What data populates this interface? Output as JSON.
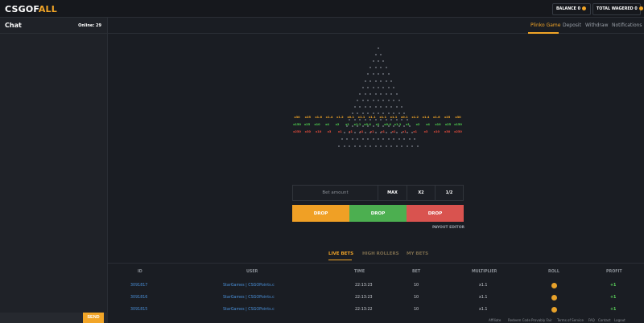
{
  "brand": {
    "logo_main": "CSGOF",
    "logo_accent": "ALL",
    "accent_color": "#f2a527"
  },
  "header": {
    "balance": "BALANCE 0",
    "total_wagered": "TOTAL WAGERED 0"
  },
  "chat": {
    "title": "Chat",
    "online": "Online: 29",
    "send": "SEND"
  },
  "nav": [
    {
      "label": "Plinko Game",
      "active": true
    },
    {
      "label": "Deposit",
      "active": false
    },
    {
      "label": "Withdraw",
      "active": false
    },
    {
      "label": "Notifications",
      "active": false
    }
  ],
  "plinko": {
    "rows": 16,
    "multipliers": {
      "orange": [
        "x30",
        "x25",
        "x1.6",
        "x1.4",
        "x1.2",
        "x0.1",
        "x1.1",
        "x1.1",
        "x1.1",
        "x1.1",
        "x0.1",
        "x1.2",
        "x1.4",
        "x1.6",
        "x25",
        "x30"
      ],
      "green": [
        "x150",
        "x25",
        "x10",
        "x4",
        "x2",
        "x1",
        "x1.1",
        "x0.4",
        "x1",
        "x0.4",
        "x1.1",
        "x1",
        "x2",
        "x4",
        "x10",
        "x25",
        "x150"
      ],
      "red": [
        "x250",
        "x30",
        "x10",
        "x3",
        "x1",
        "x1",
        "x1",
        "x1",
        "x1",
        "x1",
        "x1",
        "x1",
        "x3",
        "x10",
        "x30",
        "x250"
      ]
    },
    "colors": {
      "orange": "#f2a527",
      "green": "#4fd14f",
      "red": "#e74c3c"
    }
  },
  "controls": {
    "bet_placeholder": "Bet amount",
    "max": "MAX",
    "x2": "X2",
    "half": "1/2",
    "drop_labels": [
      "DROP",
      "DROP",
      "DROP"
    ],
    "payout_editor": "PAYOUT EDITOR"
  },
  "bets_tabs": [
    {
      "label": "LIVE BETS",
      "active": true
    },
    {
      "label": "HIGH ROLLERS",
      "active": false
    },
    {
      "label": "MY BETS",
      "active": false
    }
  ],
  "table": {
    "headers": [
      "ID",
      "USER",
      "TIME",
      "BET",
      "MULTIPLIER",
      "ROLL",
      "PROFIT"
    ],
    "rows": [
      {
        "id": "3091817",
        "user": "StarGames | CSGOPoints.c",
        "time": "22:13:23",
        "bet": "10",
        "multiplier": "x1.1",
        "profit": "+1"
      },
      {
        "id": "3091816",
        "user": "StarGames | CSGOPoints.c",
        "time": "22:13:23",
        "bet": "10",
        "multiplier": "x1.1",
        "profit": "+1"
      },
      {
        "id": "3091815",
        "user": "StarGames | CSGOPoints.c",
        "time": "22:13:22",
        "bet": "10",
        "multiplier": "x1.1",
        "profit": "+1"
      }
    ]
  },
  "footer": [
    "Affiliate",
    "Redeem Code",
    "Provably Fair",
    "Terms of Service",
    "FAQ",
    "Contact",
    "Logout"
  ]
}
